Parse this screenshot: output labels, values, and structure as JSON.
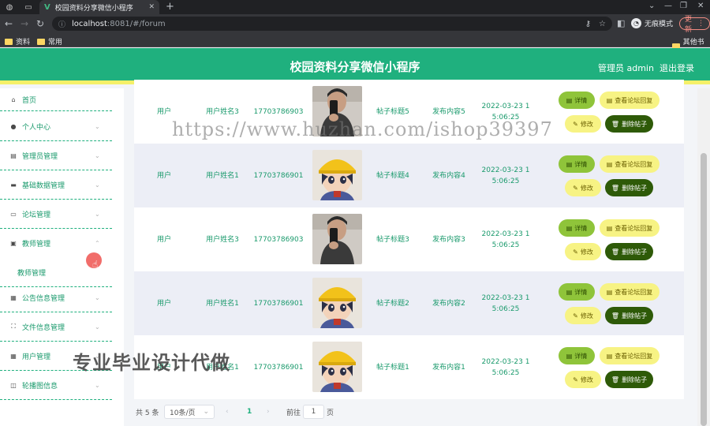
{
  "browser": {
    "tab_title": "校园资料分享微信小程序",
    "tab_favicon": "V",
    "url_host": "localhost",
    "url_path": ":8081/#/forum",
    "incognito_label": "无痕模式",
    "update_label": "更新",
    "bookmarks": [
      "资料",
      "常用"
    ],
    "other_bookmarks": "其他书签"
  },
  "header": {
    "title": "校园资料分享微信小程序",
    "admin": "管理员 admin",
    "logout": "退出登录"
  },
  "sidebar": {
    "items": [
      {
        "label": "首页",
        "icon": "home-icon",
        "expandable": false
      },
      {
        "label": "个人中心",
        "icon": "user-icon",
        "expandable": true
      },
      {
        "label": "管理员管理",
        "icon": "clipboard-icon",
        "expandable": true
      },
      {
        "label": "基础数据管理",
        "icon": "chat-icon",
        "expandable": true
      },
      {
        "label": "论坛管理",
        "icon": "monitor-icon",
        "expandable": true
      },
      {
        "label": "教师管理",
        "icon": "id-card-icon",
        "expandable": true,
        "open": true
      },
      {
        "label": "公告信息管理",
        "icon": "calendar-icon",
        "expandable": true
      },
      {
        "label": "文件信息管理",
        "icon": "fullscreen-icon",
        "expandable": true
      },
      {
        "label": "用户管理",
        "icon": "grid-icon",
        "expandable": true
      },
      {
        "label": "轮播图信息",
        "icon": "toggle-icon",
        "expandable": true
      }
    ],
    "submenu_label": "教师管理"
  },
  "table": {
    "rows": [
      {
        "role": "用户",
        "name": "用户姓名3",
        "phone": "17703786903",
        "title": "帖子标题5",
        "content": "发布内容5",
        "date": "2022-03-23 1",
        "time": "5:06:25",
        "avatar": "man"
      },
      {
        "role": "用户",
        "name": "用户姓名1",
        "phone": "17703786901",
        "title": "帖子标题4",
        "content": "发布内容4",
        "date": "2022-03-23 1",
        "time": "5:06:25",
        "avatar": "boy"
      },
      {
        "role": "用户",
        "name": "用户姓名3",
        "phone": "17703786903",
        "title": "帖子标题3",
        "content": "发布内容3",
        "date": "2022-03-23 1",
        "time": "5:06:25",
        "avatar": "man"
      },
      {
        "role": "用户",
        "name": "用户姓名1",
        "phone": "17703786901",
        "title": "帖子标题2",
        "content": "发布内容2",
        "date": "2022-03-23 1",
        "time": "5:06:25",
        "avatar": "boy"
      },
      {
        "role": "用户",
        "name": "用户姓名1",
        "phone": "17703786901",
        "title": "帖子标题1",
        "content": "发布内容1",
        "date": "2022-03-23 1",
        "time": "5:06:25",
        "avatar": "boy"
      }
    ],
    "actions": {
      "detail": "详情",
      "reply": "查看论坛回复",
      "edit": "修改",
      "delete": "删除帖子"
    }
  },
  "pagination": {
    "total": "共 5 条",
    "page_size": "10条/页",
    "current": "1",
    "goto_label": "前往",
    "goto_value": "1",
    "page_suffix": "页"
  },
  "watermarks": {
    "url": "https://www.huzhan.com/ishop39397",
    "ad": "专业毕业设计代做"
  },
  "colors": {
    "primary": "#1fb07e",
    "accent_yellow": "#f5f069",
    "detail_green": "#8fc43a",
    "delete_dark": "#2e5a08"
  }
}
